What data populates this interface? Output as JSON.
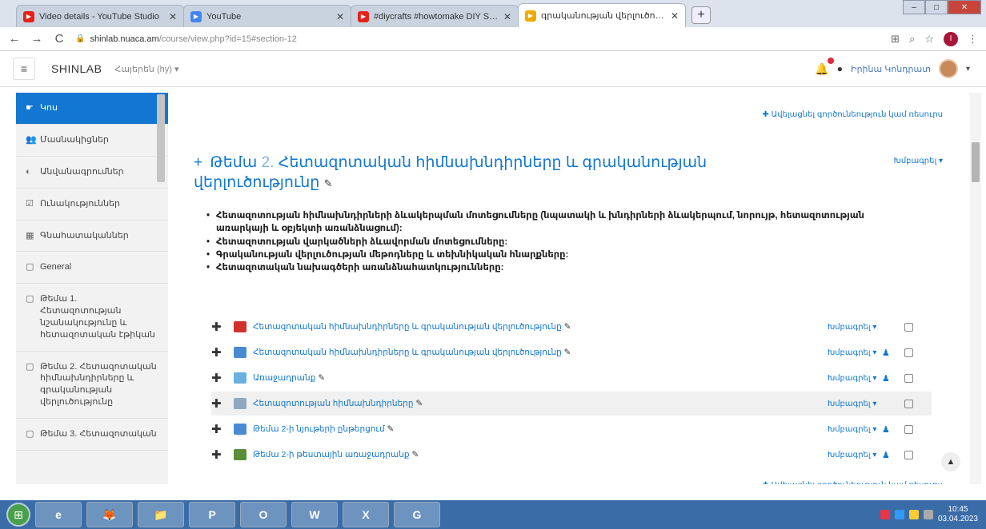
{
  "browser": {
    "tabs": [
      {
        "label": "Video details - YouTube Studio",
        "fav_color": "#e62117",
        "active": false
      },
      {
        "label": "YouTube",
        "fav_color": "#4285f4",
        "active": false
      },
      {
        "label": "#diycrafts #howtomake DIY SCU",
        "fav_color": "#e62117",
        "active": false
      },
      {
        "label": "գրականության վերլուծություն",
        "fav_color": "#f2a900",
        "active": true
      }
    ],
    "new_tab_glyph": "+",
    "url_domain": "shinlab.nuaca.am",
    "url_path": "/course/view.php?id=15#section-12",
    "profile_letter": "I"
  },
  "header": {
    "brand": "SHINLAB",
    "language": "Հայերեն (hy) ▾",
    "user_name": "Իրինա Կոնդրատ",
    "accent": "#1177d1"
  },
  "sidebar": {
    "items": [
      {
        "icon": "home-icon",
        "glyph": "☛",
        "label": "Կոս",
        "active": true
      },
      {
        "icon": "users-icon",
        "glyph": "👥",
        "label": "Մասնակիցներ",
        "active": false
      },
      {
        "icon": "badge-icon",
        "glyph": "◐",
        "label": "Անվանագրումներ",
        "active": false
      },
      {
        "icon": "competency-icon",
        "glyph": "☑",
        "label": "Ունակություններ",
        "active": false
      },
      {
        "icon": "grades-icon",
        "glyph": "▦",
        "label": "Գնահատականներ",
        "active": false
      },
      {
        "icon": "folder-icon",
        "glyph": "▢",
        "label": "General",
        "active": false
      },
      {
        "icon": "folder-icon",
        "glyph": "▢",
        "label": "Թեմա 1. Հետազոտության նշանակությունը և հետազոտական էթիկան",
        "active": false
      },
      {
        "icon": "folder-icon",
        "glyph": "▢",
        "label": "Թեմա 2. Հետազոտական հիմնախնդիրները և գրականության վերլուծությունը",
        "active": false
      },
      {
        "icon": "folder-icon",
        "glyph": "▢",
        "label": "Թեմա 3. Հետազոտական",
        "active": false
      }
    ]
  },
  "main": {
    "add_activity_label": "✚ Ավելացնել գործունեություն կամ ռեսուրս",
    "section": {
      "plus": "+",
      "prefix": "Թեմա",
      "number": "2.",
      "title": "Հետազոտական հիմնախնդիրները և գրականության վերլուծությունը",
      "edit_label": "Խմբագրել ▾"
    },
    "bullets": [
      "Հետազոտության հիմնախնդիրների ձևակերպման մոտեցումները (նպատակի և խնդիրների ձևակերպում, նորույթ, հետազոտության առարկայի և օբյեկտի առանձնացում):",
      "Հետազոտության վարկածների ձևավորման մոտեցումները:",
      "Գրականության վերլուծության մեթոդները և տեխնիկական հնարքները:",
      "Հետազոտական նախագծերի առանձնահատկությունները:"
    ],
    "activities": [
      {
        "icon": "pdf-icon",
        "icon_color": "#d0312d",
        "name": "Հետազոտական հիմնախնդիրները և գրականության վերլուծությունը",
        "edit": "Խմբագրել ▾",
        "has_user": false,
        "highlight": false
      },
      {
        "icon": "page-icon",
        "icon_color": "#4a8ad4",
        "name": "Հետազոտական հիմնախնդիրները և գրականության վերլուծությունը",
        "edit": "Խմբագրել ▾",
        "has_user": true,
        "highlight": false
      },
      {
        "icon": "assignment-icon",
        "icon_color": "#6ab0e0",
        "name": "Առաջադրանք",
        "edit": "Խմբագրել ▾",
        "has_user": true,
        "highlight": false
      },
      {
        "icon": "forum-icon",
        "icon_color": "#8fa8c0",
        "name": "Հետազոտության հիմնախնդիրները",
        "edit": "Խմբագրել ▾",
        "has_user": false,
        "highlight": true
      },
      {
        "icon": "page-icon",
        "icon_color": "#4a8ad4",
        "name": "Թեմա 2-ի նյութերի ընթերցում",
        "edit": "Խմբագրել ▾",
        "has_user": true,
        "highlight": false
      },
      {
        "icon": "quiz-icon",
        "icon_color": "#5a8f3a",
        "name": "Թեմա 2-ի թեստային առաջադրանք",
        "edit": "Խմբագրել ▾",
        "has_user": true,
        "highlight": false
      }
    ]
  },
  "taskbar": {
    "apps": [
      "e",
      "🦊",
      "📁",
      "P",
      "O",
      "W",
      "X",
      "G"
    ],
    "clock_time": "10:45",
    "clock_date": "03.04.2023"
  }
}
